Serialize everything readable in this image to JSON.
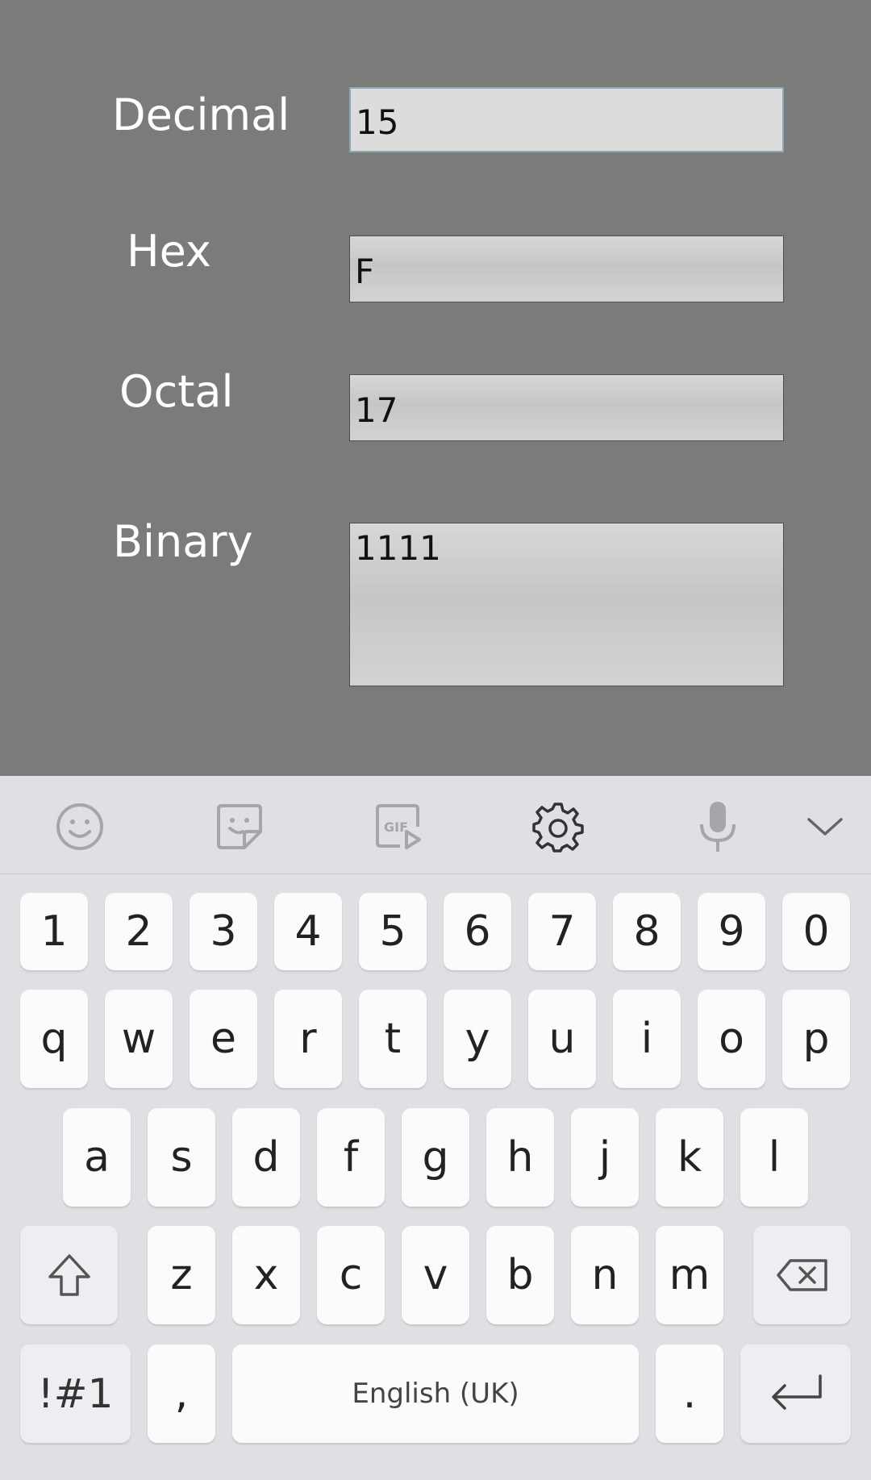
{
  "converter": {
    "decimal": {
      "label": "Decimal",
      "value": "15"
    },
    "hex": {
      "label": "Hex",
      "value": "F"
    },
    "octal": {
      "label": "Octal",
      "value": "17"
    },
    "binary": {
      "label": "Binary",
      "value": "1111"
    }
  },
  "keyboard": {
    "toolbar_icons": [
      "emoji-icon",
      "sticker-icon",
      "gif-icon",
      "settings-icon",
      "microphone-icon",
      "collapse-chevron-icon"
    ],
    "number_row": [
      "1",
      "2",
      "3",
      "4",
      "5",
      "6",
      "7",
      "8",
      "9",
      "0"
    ],
    "row1": [
      "q",
      "w",
      "e",
      "r",
      "t",
      "y",
      "u",
      "i",
      "o",
      "p"
    ],
    "row2": [
      "a",
      "s",
      "d",
      "f",
      "g",
      "h",
      "j",
      "k",
      "l"
    ],
    "row3": [
      "z",
      "x",
      "c",
      "v",
      "b",
      "n",
      "m"
    ],
    "symbols_label": "!#1",
    "comma_label": ",",
    "space_label": "English (UK)",
    "period_label": "."
  },
  "colors": {
    "app_background": "#7b7c79",
    "keyboard_background": "#dfe0e4",
    "key_background": "#fbfbfb"
  }
}
